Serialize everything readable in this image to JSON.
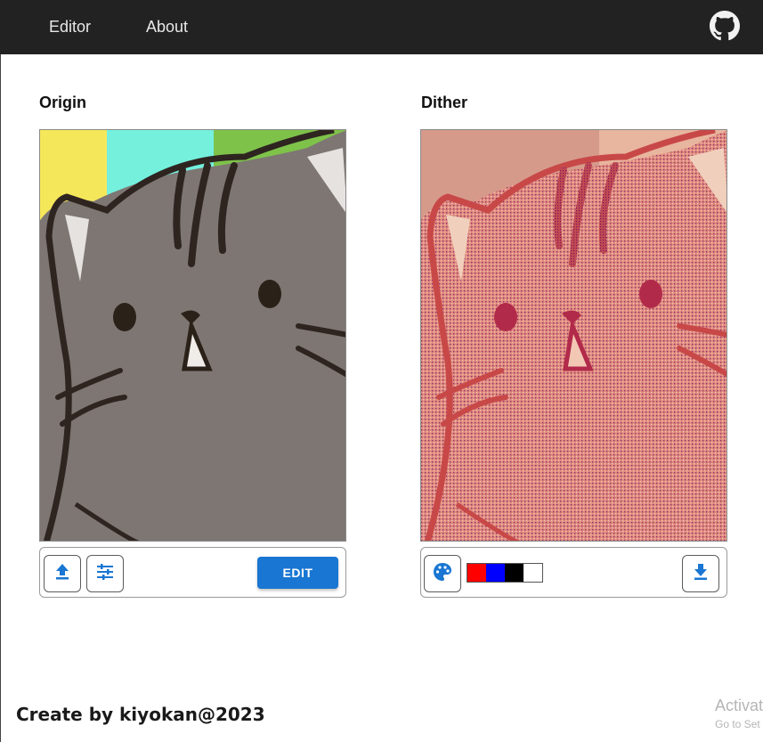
{
  "nav": {
    "items": [
      {
        "label": "Editor"
      },
      {
        "label": "About"
      }
    ],
    "github_icon": "github-icon"
  },
  "origin": {
    "title": "Origin",
    "upload_icon": "upload-icon",
    "settings_icon": "tune-icon",
    "edit_label": "EDIT"
  },
  "dither": {
    "title": "Dither",
    "palette_icon": "palette-icon",
    "palette_colors": [
      "#ff0000",
      "#0000ff",
      "#000000",
      "#ffffff"
    ],
    "download_icon": "download-icon"
  },
  "footer": {
    "credit": "Create by kiyokan@2023"
  },
  "watermark": {
    "line1": "Activat",
    "line2": "Go to Set"
  },
  "colors": {
    "topbar": "#222222",
    "accent": "#1976d2"
  }
}
